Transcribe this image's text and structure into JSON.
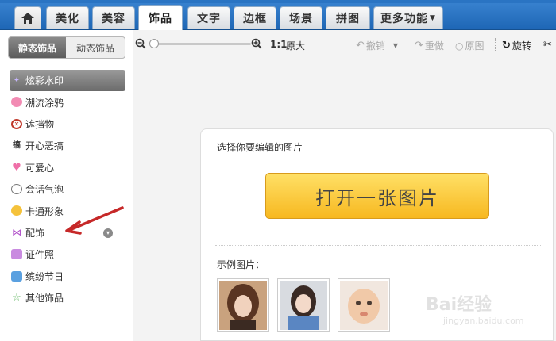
{
  "nav": {
    "tabs": [
      "美化",
      "美容",
      "饰品",
      "文字",
      "边框",
      "场景",
      "拼图",
      "更多功能"
    ],
    "active_tab": "饰品"
  },
  "sidebar": {
    "subtabs": [
      "静态饰品",
      "动态饰品"
    ],
    "items": [
      {
        "label": "炫彩水印",
        "icon": "sparkle-icon",
        "active": true
      },
      {
        "label": "潮流涂鸦",
        "icon": "lips-icon"
      },
      {
        "label": "遮挡物",
        "icon": "block-icon"
      },
      {
        "label": "开心恶搞",
        "icon": "funny-icon"
      },
      {
        "label": "可爱心",
        "icon": "heart-icon"
      },
      {
        "label": "会话气泡",
        "icon": "speech-bubble-icon"
      },
      {
        "label": "卡通形象",
        "icon": "cartoon-icon"
      },
      {
        "label": "配饰",
        "icon": "bow-icon"
      },
      {
        "label": "证件照",
        "icon": "shirt-icon"
      },
      {
        "label": "缤纷节日",
        "icon": "gift-icon"
      },
      {
        "label": "其他饰品",
        "icon": "star-icon"
      }
    ]
  },
  "toolbar": {
    "ratio": "1:1",
    "original_size": "原大",
    "undo": "撤销",
    "redo": "重做",
    "original_image": "原图",
    "rotate": "旋转"
  },
  "main": {
    "prompt": "选择你要编辑的图片",
    "open_button": "打开一张图片",
    "sample_label": "示例图片："
  },
  "watermark": {
    "brand": "Bai经验",
    "url": "jingyan.baidu.com"
  },
  "colors": {
    "nav_blue": "#1e66b5",
    "button_yellow": "#f7b820",
    "annotation_red": "#c62828"
  }
}
